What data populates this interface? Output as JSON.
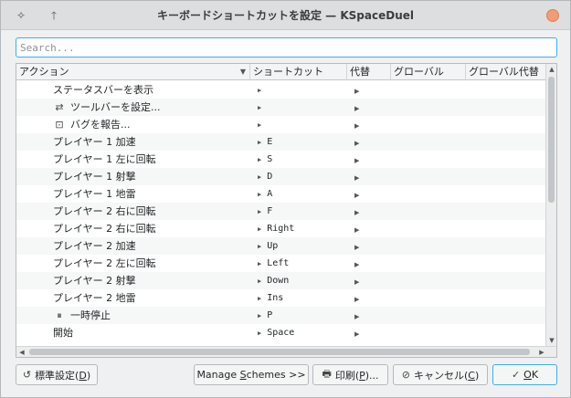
{
  "window": {
    "title": "キーボードショートカットを設定 — KSpaceDuel"
  },
  "search": {
    "placeholder": "Search..."
  },
  "table": {
    "columns": [
      "アクション",
      "ショートカット",
      "代替",
      "グローバル",
      "グローバル代替"
    ],
    "rows": [
      {
        "icon": "",
        "action": "ステータスバーを表示",
        "shortcut": ""
      },
      {
        "icon": "⇄",
        "action": "ツールバーを設定...",
        "shortcut": ""
      },
      {
        "icon": "⊡",
        "action": "バグを報告...",
        "shortcut": ""
      },
      {
        "icon": "",
        "action": "プレイヤー 1 加速",
        "shortcut": "E"
      },
      {
        "icon": "",
        "action": "プレイヤー 1 左に回転",
        "shortcut": "S"
      },
      {
        "icon": "",
        "action": "プレイヤー 1 射撃",
        "shortcut": "D"
      },
      {
        "icon": "",
        "action": "プレイヤー 1 地雷",
        "shortcut": "A"
      },
      {
        "icon": "",
        "action": "プレイヤー 2 右に回転",
        "shortcut": "F"
      },
      {
        "icon": "",
        "action": "プレイヤー 2 右に回転",
        "shortcut": "Right"
      },
      {
        "icon": "",
        "action": "プレイヤー 2 加速",
        "shortcut": "Up"
      },
      {
        "icon": "",
        "action": "プレイヤー 2 左に回転",
        "shortcut": "Left"
      },
      {
        "icon": "",
        "action": "プレイヤー 2 射撃",
        "shortcut": "Down"
      },
      {
        "icon": "",
        "action": "プレイヤー 2 地雷",
        "shortcut": "Ins"
      },
      {
        "icon": "⏸",
        "action": "一時停止",
        "shortcut": "P"
      },
      {
        "icon": "",
        "action": "開始",
        "shortcut": "Space"
      }
    ]
  },
  "buttons": {
    "defaults": {
      "pre": "標準設定(",
      "mn": "D",
      "post": ")"
    },
    "manage": {
      "pre": "Manage ",
      "mn": "S",
      "post": "chemes >>"
    },
    "print": {
      "pre": "印刷(",
      "mn": "P",
      "post": ")..."
    },
    "cancel": {
      "pre": "キャンセル(",
      "mn": "C",
      "post": ")"
    },
    "ok": {
      "pre": "",
      "mn": "O",
      "post": "K"
    }
  }
}
